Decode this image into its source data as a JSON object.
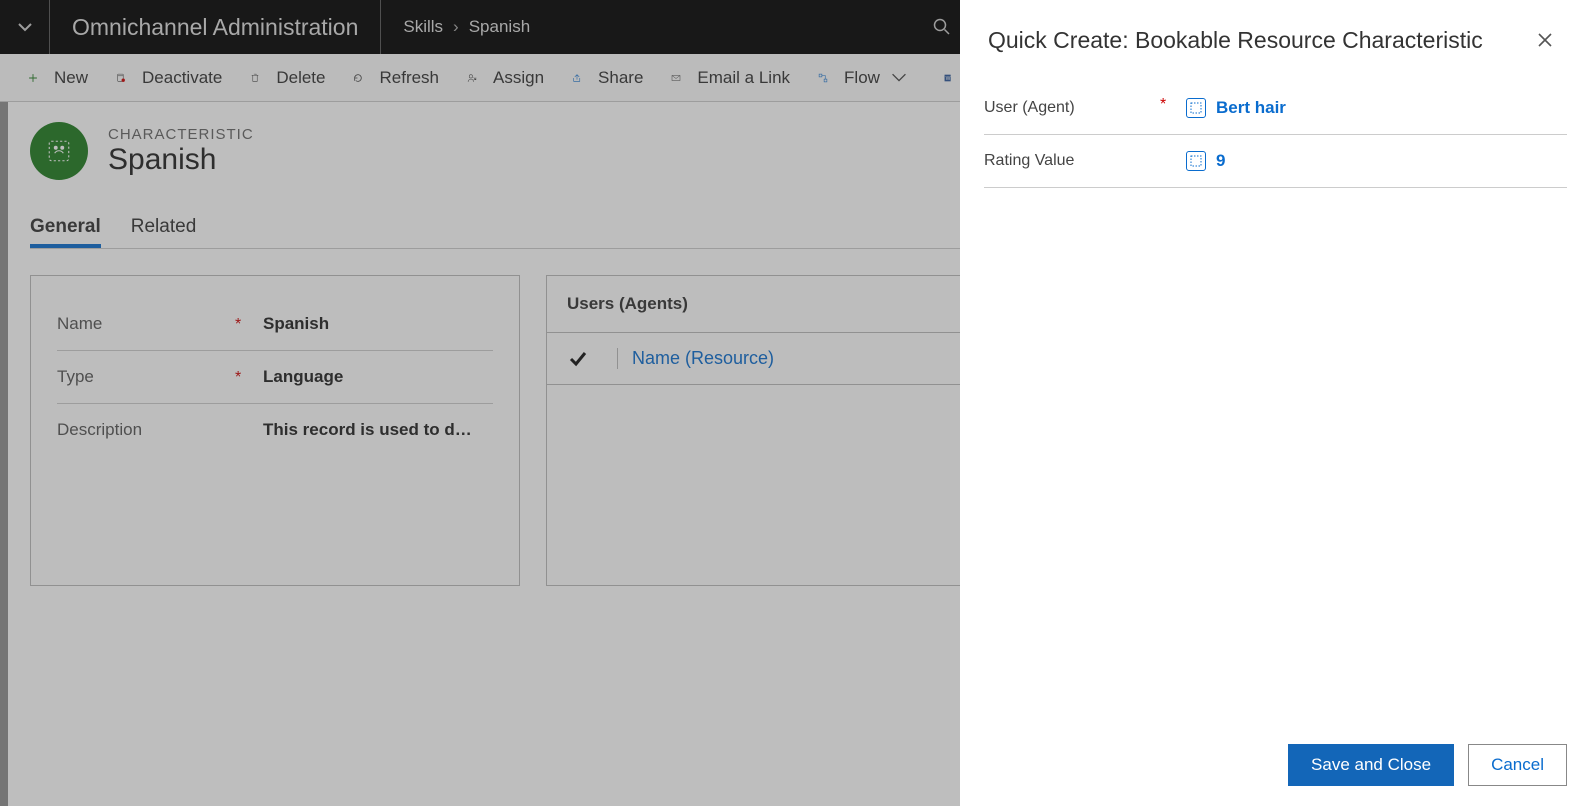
{
  "header": {
    "app_name": "Omnichannel Administration",
    "breadcrumb": [
      "Skills",
      "Spanish"
    ]
  },
  "commands": {
    "new": "New",
    "deactivate": "Deactivate",
    "delete": "Delete",
    "refresh": "Refresh",
    "assign": "Assign",
    "share": "Share",
    "email": "Email a Link",
    "flow": "Flow"
  },
  "record": {
    "entity_label": "CHARACTERISTIC",
    "title": "Spanish"
  },
  "tabs": {
    "general": "General",
    "related": "Related"
  },
  "form": {
    "name_label": "Name",
    "name_value": "Spanish",
    "type_label": "Type",
    "type_value": "Language",
    "desc_label": "Description",
    "desc_value": "This record is used to defin"
  },
  "subgrid": {
    "title": "Users (Agents)",
    "col_name": "Name (Resource)"
  },
  "quickcreate": {
    "title": "Quick Create: Bookable Resource Characteristic",
    "fields": {
      "user_label": "User (Agent)",
      "user_value": "Bert hair",
      "rating_label": "Rating Value",
      "rating_value": "9"
    },
    "save": "Save and Close",
    "cancel": "Cancel"
  }
}
